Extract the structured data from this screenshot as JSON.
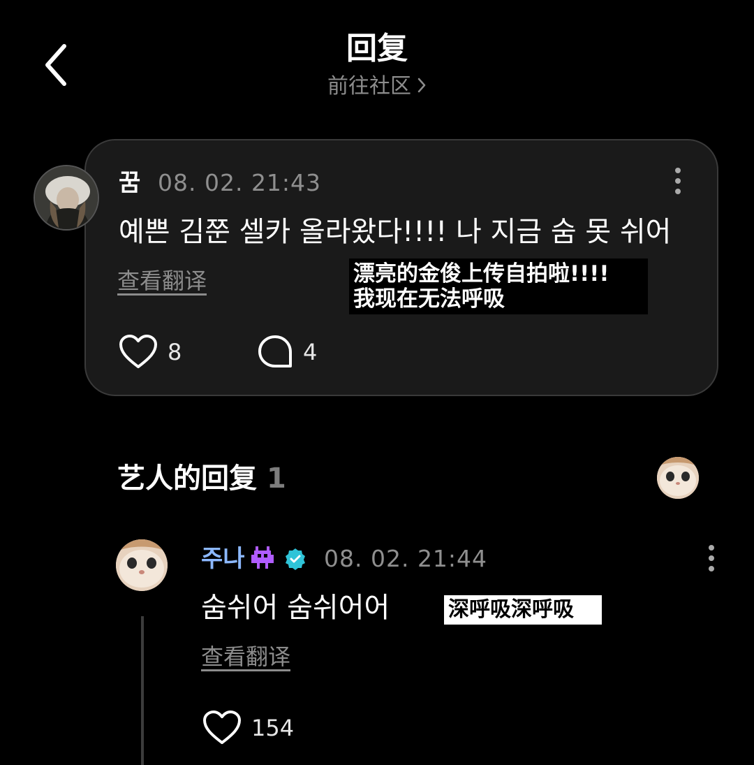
{
  "header": {
    "title": "回复",
    "community_link": "前往社区"
  },
  "post": {
    "username": "꿈",
    "timestamp": "08. 02. 21:43",
    "text": "예쁜 김쭌 셀카 올라왔다!!!! 나 지금 숨 못 쉬어",
    "translate_label": "查看翻译",
    "overlay_translation": [
      "漂亮的金俊上传自拍啦!!!!",
      "我现在无法呼吸"
    ],
    "likes": "8",
    "comments": "4"
  },
  "artist_section": {
    "title": "艺人的回复",
    "count": "1"
  },
  "reply": {
    "username": "주나",
    "timestamp": "08. 02. 21:44",
    "text": "숨쉬어 숨쉬어어",
    "overlay_translation": "深呼吸深呼吸",
    "translate_label": "查看翻译",
    "likes": "154"
  },
  "colors": {
    "background": "#000000",
    "card": "#1a1a1a",
    "artist_name": "#8cb8ff",
    "alien": "#b05cff",
    "verified": "#2fc4d8",
    "muted_text": "#8f8f8f"
  },
  "icons": [
    "back-arrow-icon",
    "chevron-right-icon",
    "more-vertical-icon",
    "heart-icon",
    "comment-bubble-icon",
    "alien-icon",
    "verified-badge-icon"
  ]
}
